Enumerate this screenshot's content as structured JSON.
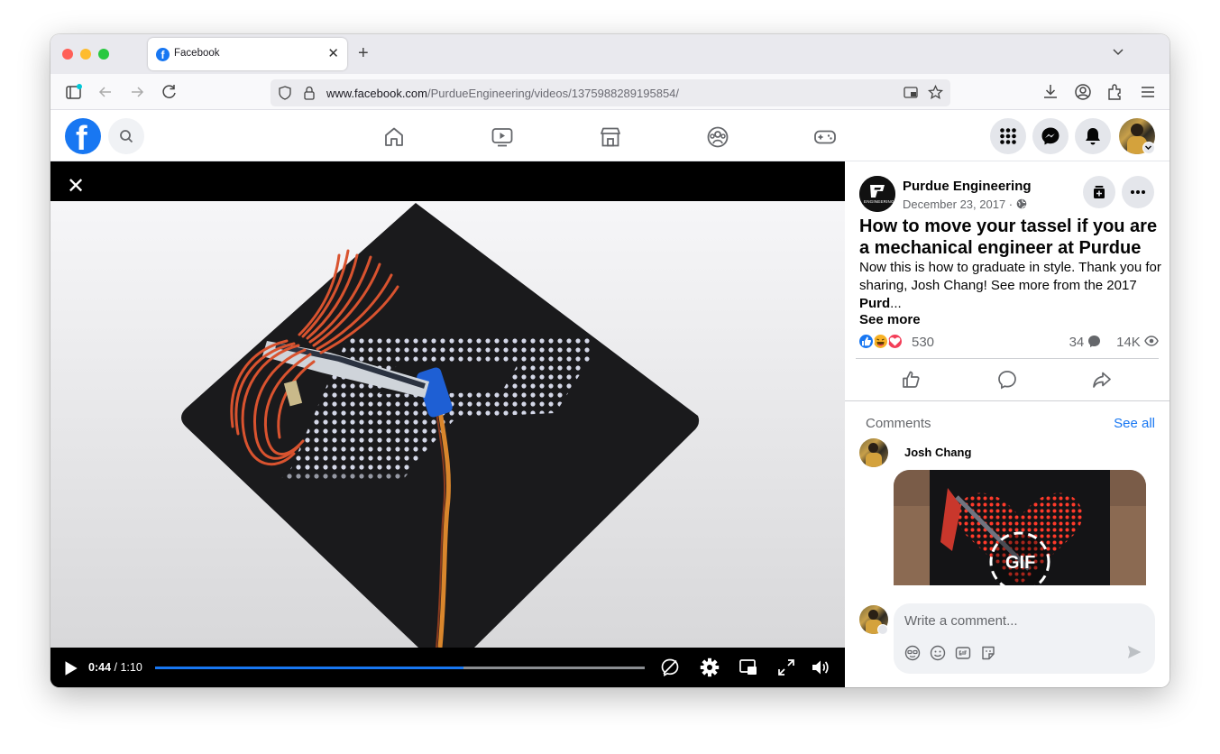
{
  "browser": {
    "tab_title": "Facebook",
    "url_host": "www.facebook.com",
    "url_path": "/PurdueEngineering/videos/1375988289195854/"
  },
  "fb_header": {
    "logo_letter": "f",
    "icons": [
      "search-icon",
      "home-icon",
      "watch-icon",
      "marketplace-icon",
      "groups-icon",
      "gaming-icon",
      "menu-grid-icon",
      "messenger-icon",
      "notifications-icon",
      "account-avatar"
    ]
  },
  "video": {
    "current_time": "0:44",
    "duration": "1:10",
    "progress": 0.63
  },
  "post": {
    "page_name": "Purdue Engineering",
    "page_logo_text": "ENGINEERING",
    "date": "December 23, 2017 · ",
    "title": "How to move your tassel if you are a mechanical engineer at Purdue",
    "description": "Now this is how to graduate in style. Thank you for sharing, Josh Chang! See more from the 2017 ",
    "description_bold": "Purd",
    "description_end": "...",
    "see_more": "See more",
    "reaction_count": "530",
    "comment_count": "34",
    "view_count": "14K"
  },
  "comments": {
    "title": "Comments",
    "see_all": "See all",
    "first_author": "Josh Chang",
    "gif_label": "GIF",
    "placeholder": "Write a comment..."
  },
  "colors": {
    "fb_blue": "#1877f2",
    "tassel": "#d9532f",
    "heart_red": "#f33e58",
    "haha_yellow": "#f7b125"
  }
}
